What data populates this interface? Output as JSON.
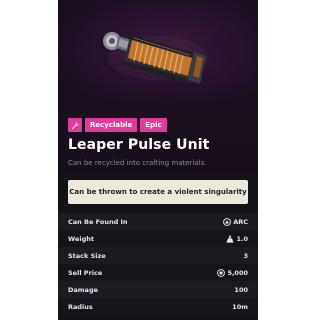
{
  "item": {
    "tags": [
      "Recyclable",
      "Epic"
    ],
    "tag_icon": "wrench-icon",
    "name": "Leaper Pulse Unit",
    "subtitle": "Can be recycled into crafting materials.",
    "description": "Can be thrown to create a violent singularity"
  },
  "stats": {
    "found_in": {
      "label": "Can Be Found In",
      "value": "ARC",
      "icon": "arc-icon"
    },
    "weight": {
      "label": "Weight",
      "value": "1.0",
      "icon": "weight-icon"
    },
    "stack_size": {
      "label": "Stack Size",
      "value": "3"
    },
    "sell_price": {
      "label": "Sell Price",
      "value": "5,000",
      "icon": "coin-icon"
    },
    "damage": {
      "label": "Damage",
      "value": "100"
    },
    "radius": {
      "label": "Radius",
      "value": "10m"
    }
  },
  "colors": {
    "tag": "#e03a9c",
    "panel_bg": "#131317",
    "description_bg": "#ece9dc"
  }
}
